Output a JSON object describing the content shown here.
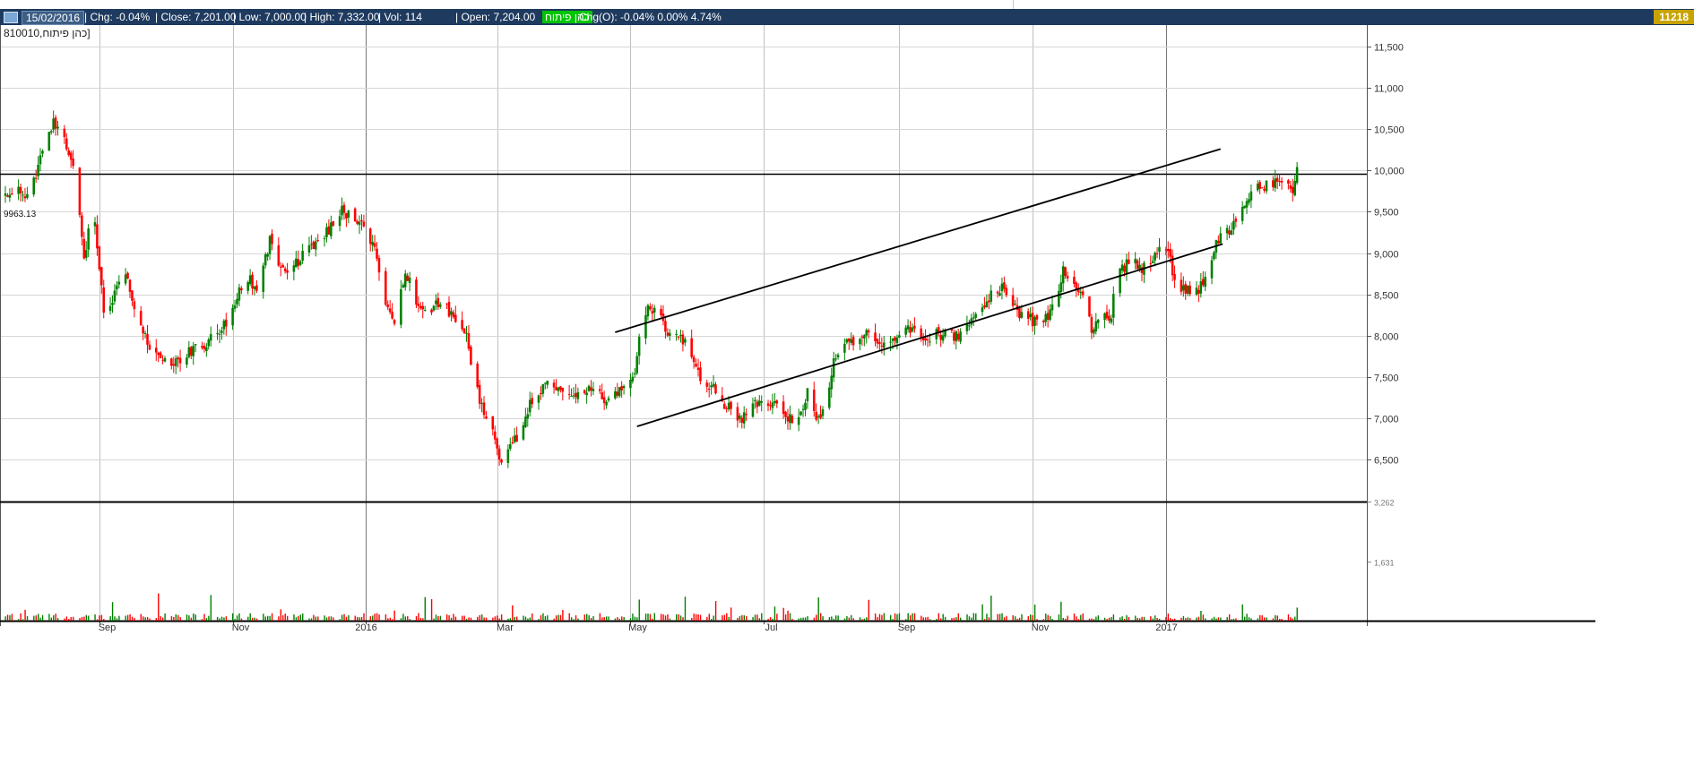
{
  "header": {
    "date": "15/02/2016",
    "chg": "| Chg: -0.04%",
    "close": "| Close: 7,201.00",
    "low": "| Low: 7,000.00",
    "high": "| High: 7,332.00",
    "vol": "| Vol: 114",
    "open": "| Open: 7,204.00",
    "badge": "כהן פיתוח",
    "chg_open": "Chg(O): -0.04% 0.00% 4.74%",
    "last_value": "11218"
  },
  "instrument_label": "כהן פיתוח,810010]",
  "level_label": "9963.13",
  "colors": {
    "header_bg": "#1e3a5f",
    "up": "#008000",
    "down": "#ff0000",
    "grid": "#c0c0c0",
    "badge": "#00c400",
    "last_value_bg": "#c7a300"
  },
  "chart_data": {
    "type": "candlestick",
    "y_ticks": [
      "11,500",
      "11,000",
      "10,500",
      "10,000",
      "9,500",
      "9,000",
      "8,500",
      "8,000",
      "7,500",
      "7,000",
      "6,500"
    ],
    "volume_ticks": [
      "3,262",
      "1,631"
    ],
    "x_ticks": [
      "Sep",
      "Nov",
      "2016",
      "Mar",
      "May",
      "Jul",
      "Sep",
      "Nov",
      "2017"
    ],
    "ylim": [
      6000,
      11900
    ],
    "volume_ylim": [
      0,
      3262
    ],
    "horizontal_levels": [
      9963.13
    ],
    "trend_channel": {
      "upper": [
        [
          "2016-04-24",
          8040
        ],
        [
          "2017-01-26",
          10260
        ]
      ],
      "lower": [
        [
          "2016-05-04",
          6900
        ],
        [
          "2017-01-27",
          9110
        ]
      ]
    },
    "anchors": [
      [
        "2015-07-20",
        9700
      ],
      [
        "2015-08-01",
        9750
      ],
      [
        "2015-08-06",
        10300
      ],
      [
        "2015-08-11",
        10600
      ],
      [
        "2015-08-16",
        10400
      ],
      [
        "2015-08-21",
        9900
      ],
      [
        "2015-08-25",
        8900
      ],
      [
        "2015-08-29",
        9600
      ],
      [
        "2015-09-04",
        8100
      ],
      [
        "2015-09-08",
        8600
      ],
      [
        "2015-09-13",
        8800
      ],
      [
        "2015-09-18",
        8300
      ],
      [
        "2015-09-24",
        7850
      ],
      [
        "2015-10-04",
        7600
      ],
      [
        "2015-10-10",
        7800
      ],
      [
        "2015-10-20",
        7900
      ],
      [
        "2015-10-30",
        8200
      ],
      [
        "2015-11-07",
        8700
      ],
      [
        "2015-11-12",
        8600
      ],
      [
        "2015-11-18",
        9150
      ],
      [
        "2015-11-25",
        8750
      ],
      [
        "2015-12-05",
        9000
      ],
      [
        "2015-12-13",
        9200
      ],
      [
        "2015-12-21",
        9500
      ],
      [
        "2015-12-29",
        9400
      ],
      [
        "2016-01-05",
        9000
      ],
      [
        "2016-01-10",
        8400
      ],
      [
        "2016-01-14",
        8150
      ],
      [
        "2016-01-19",
        8800
      ],
      [
        "2016-01-24",
        8400
      ],
      [
        "2016-01-30",
        8300
      ],
      [
        "2016-02-05",
        8450
      ],
      [
        "2016-02-10",
        8200
      ],
      [
        "2016-02-15",
        8100
      ],
      [
        "2016-02-20",
        7400
      ],
      [
        "2016-02-24",
        7100
      ],
      [
        "2016-02-28",
        6800
      ],
      [
        "2016-03-03",
        6500
      ],
      [
        "2016-03-08",
        6650
      ],
      [
        "2016-03-13",
        6950
      ],
      [
        "2016-03-18",
        7300
      ],
      [
        "2016-03-25",
        7400
      ],
      [
        "2016-04-02",
        7250
      ],
      [
        "2016-04-10",
        7350
      ],
      [
        "2016-04-18",
        7250
      ],
      [
        "2016-04-26",
        7350
      ],
      [
        "2016-05-03",
        7600
      ],
      [
        "2016-05-07",
        8300
      ],
      [
        "2016-05-13",
        8350
      ],
      [
        "2016-05-19",
        8000
      ],
      [
        "2016-05-26",
        7950
      ],
      [
        "2016-06-02",
        7500
      ],
      [
        "2016-06-10",
        7300
      ],
      [
        "2016-06-17",
        7050
      ],
      [
        "2016-06-22",
        7000
      ],
      [
        "2016-06-27",
        7150
      ],
      [
        "2016-07-04",
        7200
      ],
      [
        "2016-07-11",
        7050
      ],
      [
        "2016-07-16",
        7000
      ],
      [
        "2016-07-21",
        7300
      ],
      [
        "2016-07-26",
        7000
      ],
      [
        "2016-07-30",
        7300
      ],
      [
        "2016-08-03",
        7800
      ],
      [
        "2016-08-09",
        7950
      ],
      [
        "2016-08-18",
        8000
      ],
      [
        "2016-08-28",
        7900
      ],
      [
        "2016-09-06",
        8100
      ],
      [
        "2016-09-13",
        8000
      ],
      [
        "2016-09-20",
        8000
      ],
      [
        "2016-09-27",
        8000
      ],
      [
        "2016-10-04",
        8200
      ],
      [
        "2016-10-11",
        8450
      ],
      [
        "2016-10-18",
        8600
      ],
      [
        "2016-10-23",
        8350
      ],
      [
        "2016-10-29",
        8200
      ],
      [
        "2016-11-04",
        8150
      ],
      [
        "2016-11-10",
        8300
      ],
      [
        "2016-11-15",
        8800
      ],
      [
        "2016-11-20",
        8600
      ],
      [
        "2016-11-24",
        8550
      ],
      [
        "2016-11-28",
        8100
      ],
      [
        "2016-12-02",
        8250
      ],
      [
        "2016-12-07",
        8250
      ],
      [
        "2016-12-10",
        8800
      ],
      [
        "2016-12-16",
        8900
      ],
      [
        "2016-12-21",
        8800
      ],
      [
        "2016-12-26",
        8900
      ],
      [
        "2017-01-01",
        9100
      ],
      [
        "2017-01-05",
        8700
      ],
      [
        "2017-01-10",
        8550
      ],
      [
        "2017-01-16",
        8550
      ],
      [
        "2017-01-20",
        8800
      ],
      [
        "2017-01-25",
        9150
      ],
      [
        "2017-01-31",
        9300
      ],
      [
        "2017-02-05",
        9500
      ],
      [
        "2017-02-10",
        9850
      ],
      [
        "2017-02-15",
        9800
      ],
      [
        "2017-02-20",
        9850
      ],
      [
        "2017-02-25",
        9750
      ],
      [
        "2017-03-01",
        9800
      ],
      [
        "2017-03-04",
        10350
      ]
    ]
  }
}
